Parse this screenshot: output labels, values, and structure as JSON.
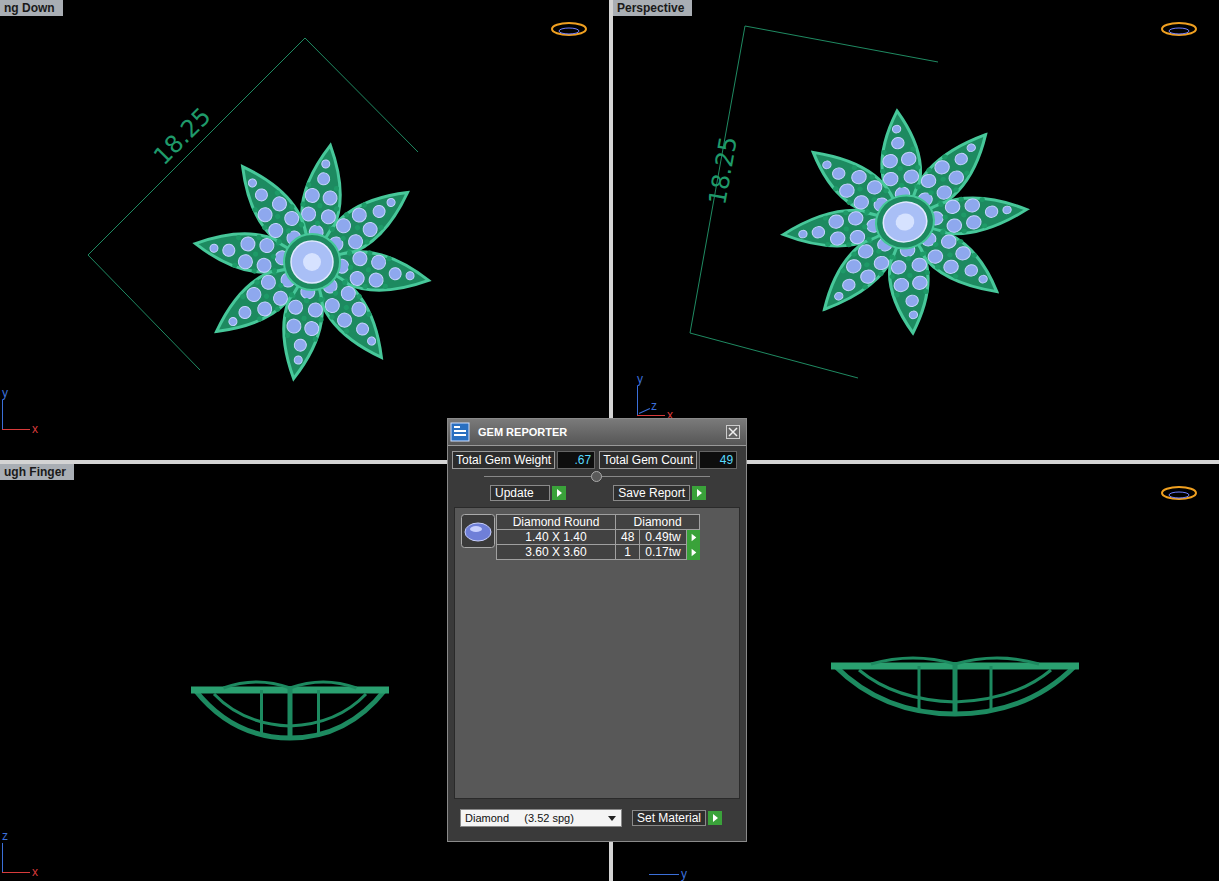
{
  "viewports": [
    {
      "label": "ng Down",
      "kind": "top",
      "dimension": "18.25",
      "axes": [
        {
          "label": "y",
          "dir": "up",
          "color": "#3b6fd8"
        },
        {
          "label": "x",
          "dir": "right",
          "color": "#d83b3b"
        }
      ]
    },
    {
      "label": "Perspective",
      "kind": "perspective",
      "dimension": "18.25",
      "axes": [
        {
          "label": "y",
          "dir": "up",
          "color": "#3b6fd8"
        },
        {
          "label": "z",
          "dir": "diag",
          "color": "#3b6fd8"
        },
        {
          "label": "x",
          "dir": "right",
          "color": "#d83b3b"
        }
      ]
    },
    {
      "label": "ugh Finger",
      "kind": "side",
      "axes": [
        {
          "label": "z",
          "dir": "up",
          "color": "#3b6fd8"
        },
        {
          "label": "x",
          "dir": "right",
          "color": "#d83b3b"
        }
      ]
    },
    {
      "kind": "side-wide",
      "axes": [
        {
          "label": "y",
          "dir": "right",
          "color": "#3b6fd8"
        }
      ]
    }
  ],
  "gem_reporter": {
    "title": "GEM REPORTER",
    "totals": [
      {
        "label": "Total Gem Weight",
        "value": ".67"
      },
      {
        "label": "Total Gem Count",
        "value": "49"
      }
    ],
    "splitter": {
      "level": 0.5
    },
    "actions": [
      "Update",
      "Save Report"
    ],
    "table": {
      "columns": [
        "Diamond Round",
        "Diamond"
      ],
      "rows": [
        {
          "size": "1.40 X 1.40",
          "count": "48",
          "weight": "0.49tw"
        },
        {
          "size": "3.60 X 3.60",
          "count": "1",
          "weight": "0.17tw"
        }
      ]
    },
    "material": {
      "value": "Diamond     (3.52 spg)",
      "button": "Set Material"
    }
  }
}
